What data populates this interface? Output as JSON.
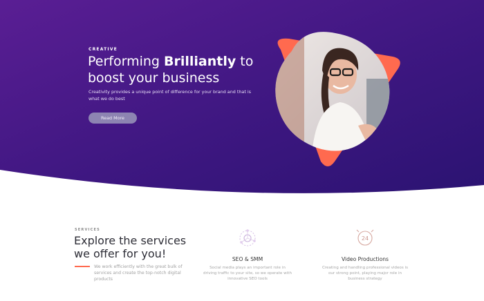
{
  "hero": {
    "eyebrow": "CREATIVE",
    "headline_part1": "Performing ",
    "headline_bold": "Brilliantly",
    "headline_part2": " to boost your business",
    "description": "Creativity provides a unique point of difference for your brand and that is what we do best",
    "cta_label": "Read More",
    "colors": {
      "gradient_start": "#5b1f95",
      "gradient_end": "#2a1270",
      "accent": "#ff6a4f"
    }
  },
  "services": {
    "eyebrow": "SERVICES",
    "title": "Explore the services we offer for you!",
    "description": "We work efficiently with the great bulk of services and create the top-notch digital products",
    "items": [
      {
        "name": "SEO & SMM",
        "icon": "seo-icon",
        "text": "Social media plays an important role in driving traffic to your site, so we operate with innovative SEO tools"
      },
      {
        "name": "Video Productions",
        "icon": "video-24-icon",
        "text": "Creating and handling professional videos is our strong point, playing major role in business strategy"
      }
    ]
  }
}
